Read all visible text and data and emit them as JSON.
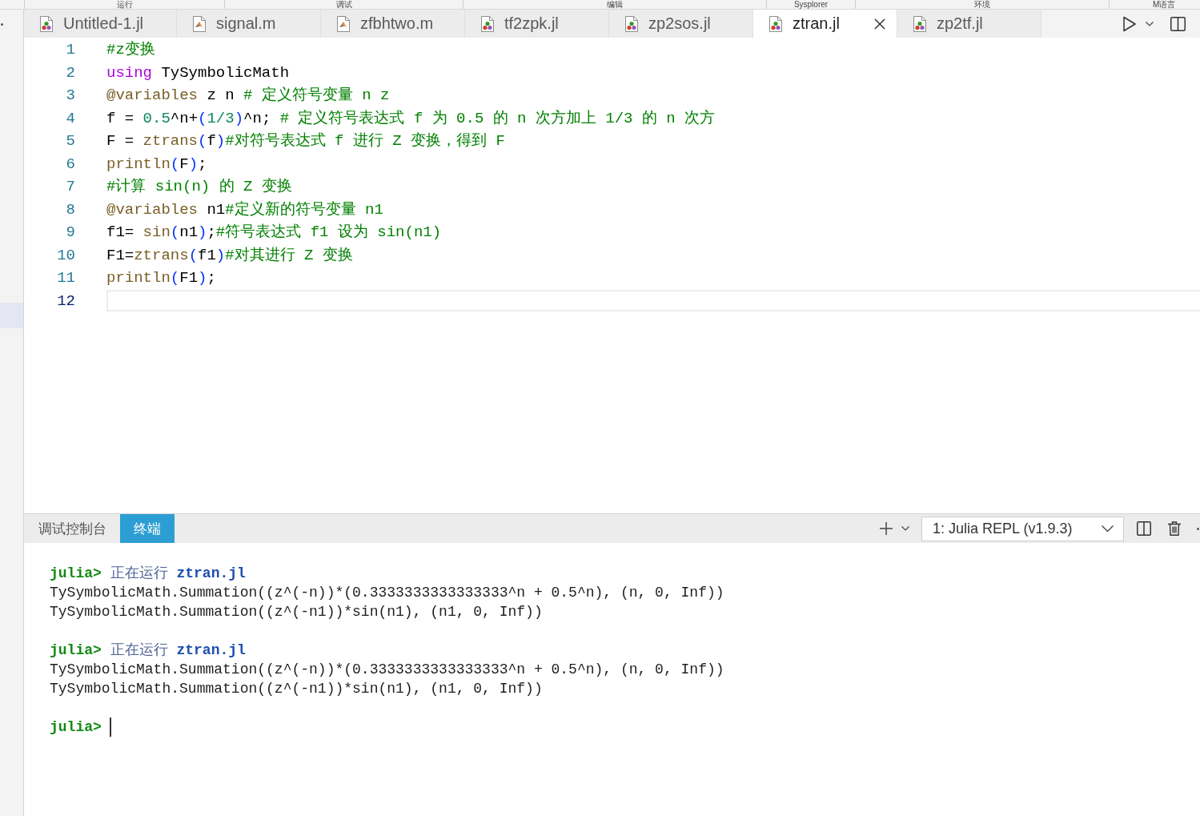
{
  "ribbon_groups": [
    "运行",
    "调试",
    "编辑",
    "Sysplorer",
    "环境",
    "M语言"
  ],
  "tabs": [
    {
      "label": "Untitled-1.jl",
      "kind": "julia",
      "selected": false
    },
    {
      "label": "signal.m",
      "kind": "matlab",
      "selected": false
    },
    {
      "label": "zfbhtwo.m",
      "kind": "matlab",
      "selected": false
    },
    {
      "label": "tf2zpk.jl",
      "kind": "julia",
      "selected": false
    },
    {
      "label": "zp2sos.jl",
      "kind": "julia",
      "selected": false
    },
    {
      "label": "ztran.jl",
      "kind": "julia",
      "selected": true
    },
    {
      "label": "zp2tf.jl",
      "kind": "julia",
      "selected": false
    }
  ],
  "editor": {
    "lines": [
      {
        "number": "1",
        "current": false,
        "tokens": [
          {
            "kind": "comment",
            "text": "#z变换"
          }
        ]
      },
      {
        "number": "2",
        "current": false,
        "tokens": [
          {
            "kind": "keyword",
            "text": "using"
          },
          {
            "kind": "plain",
            "text": " TySymbolicMath"
          }
        ]
      },
      {
        "number": "3",
        "current": false,
        "tokens": [
          {
            "kind": "macro",
            "text": "@variables"
          },
          {
            "kind": "plain",
            "text": " z n "
          },
          {
            "kind": "comment",
            "text": "# 定义符号变量 n z"
          }
        ]
      },
      {
        "number": "4",
        "current": false,
        "tokens": [
          {
            "kind": "plain",
            "text": "f = "
          },
          {
            "kind": "number",
            "text": "0.5"
          },
          {
            "kind": "plain",
            "text": "^n+"
          },
          {
            "kind": "bracket",
            "text": "("
          },
          {
            "kind": "number",
            "text": "1/3"
          },
          {
            "kind": "bracket",
            "text": ")"
          },
          {
            "kind": "plain",
            "text": "^n; "
          },
          {
            "kind": "comment",
            "text": "# 定义符号表达式 f 为 0.5 的 n 次方加上 1/3 的 n 次方"
          }
        ]
      },
      {
        "number": "5",
        "current": false,
        "tokens": [
          {
            "kind": "plain",
            "text": "F = "
          },
          {
            "kind": "function",
            "text": "ztrans"
          },
          {
            "kind": "bracket",
            "text": "("
          },
          {
            "kind": "plain",
            "text": "f"
          },
          {
            "kind": "bracket",
            "text": ")"
          },
          {
            "kind": "comment",
            "text": "#对符号表达式 f 进行 Z 变换，得到 F"
          }
        ]
      },
      {
        "number": "6",
        "current": false,
        "tokens": [
          {
            "kind": "function",
            "text": "println"
          },
          {
            "kind": "bracket",
            "text": "("
          },
          {
            "kind": "plain",
            "text": "F"
          },
          {
            "kind": "bracket",
            "text": ")"
          },
          {
            "kind": "plain",
            "text": ";"
          }
        ]
      },
      {
        "number": "7",
        "current": false,
        "tokens": [
          {
            "kind": "comment",
            "text": "#计算 sin(n) 的 Z 变换"
          }
        ]
      },
      {
        "number": "8",
        "current": false,
        "tokens": [
          {
            "kind": "macro",
            "text": "@variables"
          },
          {
            "kind": "plain",
            "text": " n1"
          },
          {
            "kind": "comment",
            "text": "#定义新的符号变量 n1"
          }
        ]
      },
      {
        "number": "9",
        "current": false,
        "tokens": [
          {
            "kind": "plain",
            "text": "f1= "
          },
          {
            "kind": "function",
            "text": "sin"
          },
          {
            "kind": "bracket",
            "text": "("
          },
          {
            "kind": "plain",
            "text": "n1"
          },
          {
            "kind": "bracket",
            "text": ")"
          },
          {
            "kind": "plain",
            "text": ";"
          },
          {
            "kind": "comment",
            "text": "#符号表达式 f1 设为 sin(n1)"
          }
        ]
      },
      {
        "number": "10",
        "current": false,
        "tokens": [
          {
            "kind": "plain",
            "text": "F1="
          },
          {
            "kind": "function",
            "text": "ztrans"
          },
          {
            "kind": "bracket",
            "text": "("
          },
          {
            "kind": "plain",
            "text": "f1"
          },
          {
            "kind": "bracket",
            "text": ")"
          },
          {
            "kind": "comment",
            "text": "#对其进行 Z 变换"
          }
        ]
      },
      {
        "number": "11",
        "current": false,
        "tokens": [
          {
            "kind": "function",
            "text": "println"
          },
          {
            "kind": "bracket",
            "text": "("
          },
          {
            "kind": "plain",
            "text": "F1"
          },
          {
            "kind": "bracket",
            "text": ")"
          },
          {
            "kind": "plain",
            "text": ";"
          }
        ]
      },
      {
        "number": "12",
        "current": true
      }
    ]
  },
  "panel": {
    "tabs": [
      {
        "label": "调试控制台",
        "selected": false
      },
      {
        "label": "终端",
        "selected": true
      }
    ],
    "terminal_select": {
      "value": "1: Julia REPL (v1.9.3)"
    }
  },
  "terminal": {
    "blocks": [
      {
        "lines": [
          {
            "cursor": false,
            "tokens": [
              {
                "kind": "prompt",
                "text": "julia>"
              },
              {
                "kind": "message",
                "text": " 正在运行"
              },
              {
                "kind": "file",
                "text": " ztran.jl"
              }
            ]
          },
          {
            "cursor": false,
            "tokens": [
              {
                "kind": "output",
                "text": "TySymbolicMath.Summation((z^(-n))*(0.3333333333333333^n + 0.5^n), (n, 0, Inf))"
              }
            ]
          },
          {
            "cursor": false,
            "tokens": [
              {
                "kind": "output",
                "text": "TySymbolicMath.Summation((z^(-n1))*sin(n1), (n1, 0, Inf))"
              }
            ]
          }
        ]
      },
      {
        "lines": [
          {
            "cursor": false,
            "tokens": [
              {
                "kind": "prompt",
                "text": "julia>"
              },
              {
                "kind": "message",
                "text": " 正在运行"
              },
              {
                "kind": "file",
                "text": " ztran.jl"
              }
            ]
          },
          {
            "cursor": false,
            "tokens": [
              {
                "kind": "output",
                "text": "TySymbolicMath.Summation((z^(-n))*(0.3333333333333333^n + 0.5^n), (n, 0, Inf))"
              }
            ]
          },
          {
            "cursor": false,
            "tokens": [
              {
                "kind": "output",
                "text": "TySymbolicMath.Summation((z^(-n1))*sin(n1), (n1, 0, Inf))"
              }
            ]
          }
        ]
      },
      {
        "lines": [
          {
            "cursor": true,
            "tokens": [
              {
                "kind": "prompt",
                "text": "julia>"
              }
            ]
          }
        ]
      }
    ]
  }
}
